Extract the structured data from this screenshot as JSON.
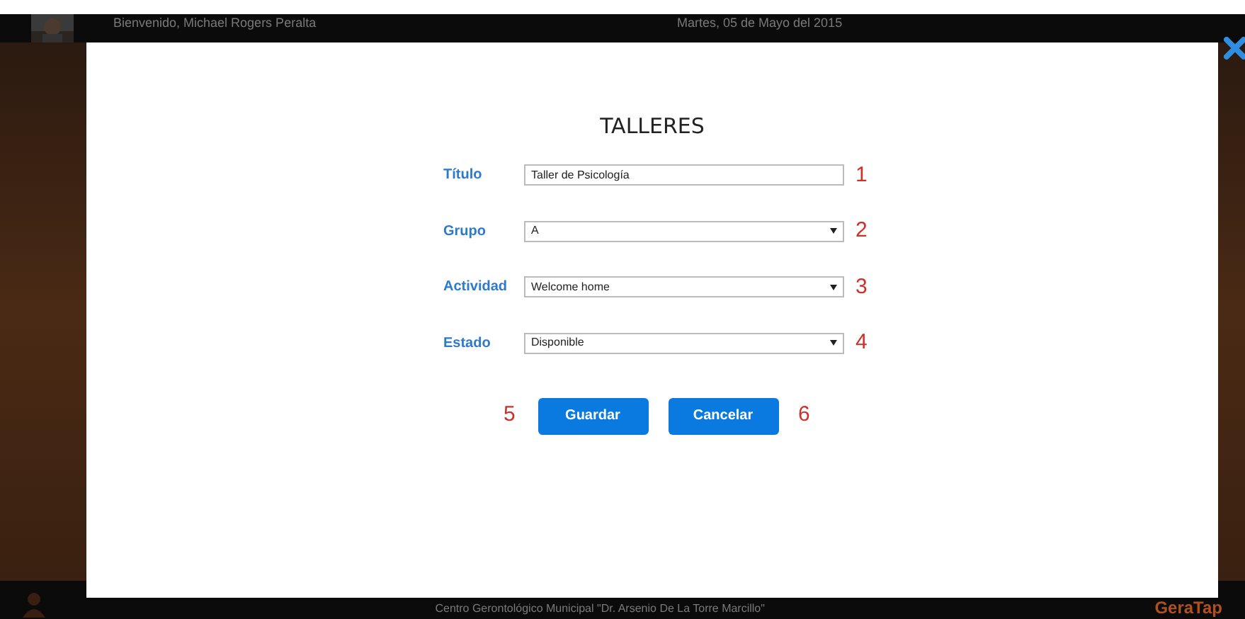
{
  "header": {
    "welcome": "Bienvenido, Michael Rogers Peralta",
    "date": "Martes, 05 de Mayo del 2015"
  },
  "dialog": {
    "title": "TALLERES",
    "fields": [
      {
        "kind": "text",
        "label": "Título",
        "value": "Taller de Psicología",
        "marker": "1"
      },
      {
        "kind": "select",
        "label": "Grupo",
        "value": "A",
        "marker": "2"
      },
      {
        "kind": "select",
        "label": "Actividad",
        "value": "Welcome home",
        "marker": "3"
      },
      {
        "kind": "select",
        "label": "Estado",
        "value": "Disponible",
        "marker": "4"
      }
    ],
    "actions": [
      {
        "kind": "marker",
        "text": "5"
      },
      {
        "kind": "button",
        "text": "Guardar"
      },
      {
        "kind": "button",
        "text": "Cancelar"
      },
      {
        "kind": "marker",
        "text": "6"
      }
    ]
  },
  "footer": {
    "text": "Centro Gerontológico Municipal \"Dr. Arsenio De La Torre Marcillo\"",
    "logo": "GeraTap"
  }
}
